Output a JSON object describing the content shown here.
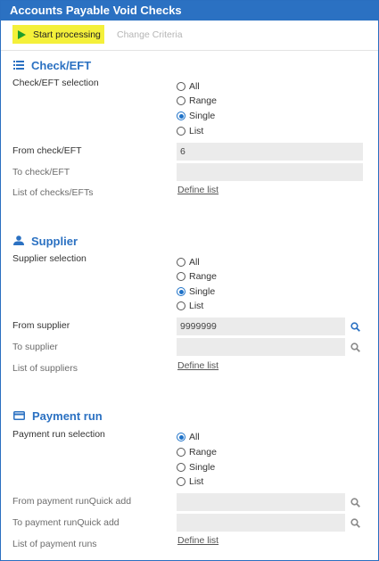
{
  "window": {
    "title": "Accounts Payable Void Checks"
  },
  "toolbar": {
    "start_label": "Start processing",
    "change_label": "Change Criteria"
  },
  "check_section": {
    "title": "Check/EFT",
    "icon": "list-icon",
    "selection_label": "Check/EFT selection",
    "options": [
      "All",
      "Range",
      "Single",
      "List"
    ],
    "selected": "Single",
    "from_label": "From check/EFT",
    "from_value": "6",
    "to_label": "To check/EFT",
    "to_value": "",
    "list_label": "List of checks/EFTs",
    "define_list": "Define list"
  },
  "supplier_section": {
    "title": "Supplier",
    "icon": "person-icon",
    "selection_label": "Supplier selection",
    "options": [
      "All",
      "Range",
      "Single",
      "List"
    ],
    "selected": "Single",
    "from_label": "From supplier",
    "from_value": "9999999",
    "to_label": "To supplier",
    "to_value": "",
    "list_label": "List of suppliers",
    "define_list": "Define list"
  },
  "payment_section": {
    "title": "Payment run",
    "icon": "card-icon",
    "selection_label": "Payment run selection",
    "options": [
      "All",
      "Range",
      "Single",
      "List"
    ],
    "selected": "All",
    "from_label": "From payment runQuick add",
    "from_value": "",
    "to_label": "To payment runQuick add",
    "to_value": "",
    "list_label": "List of payment runs",
    "define_list": "Define list"
  },
  "colors": {
    "accent": "#2b71c2",
    "highlight": "#f4f03a",
    "play": "#1e9d2a"
  }
}
